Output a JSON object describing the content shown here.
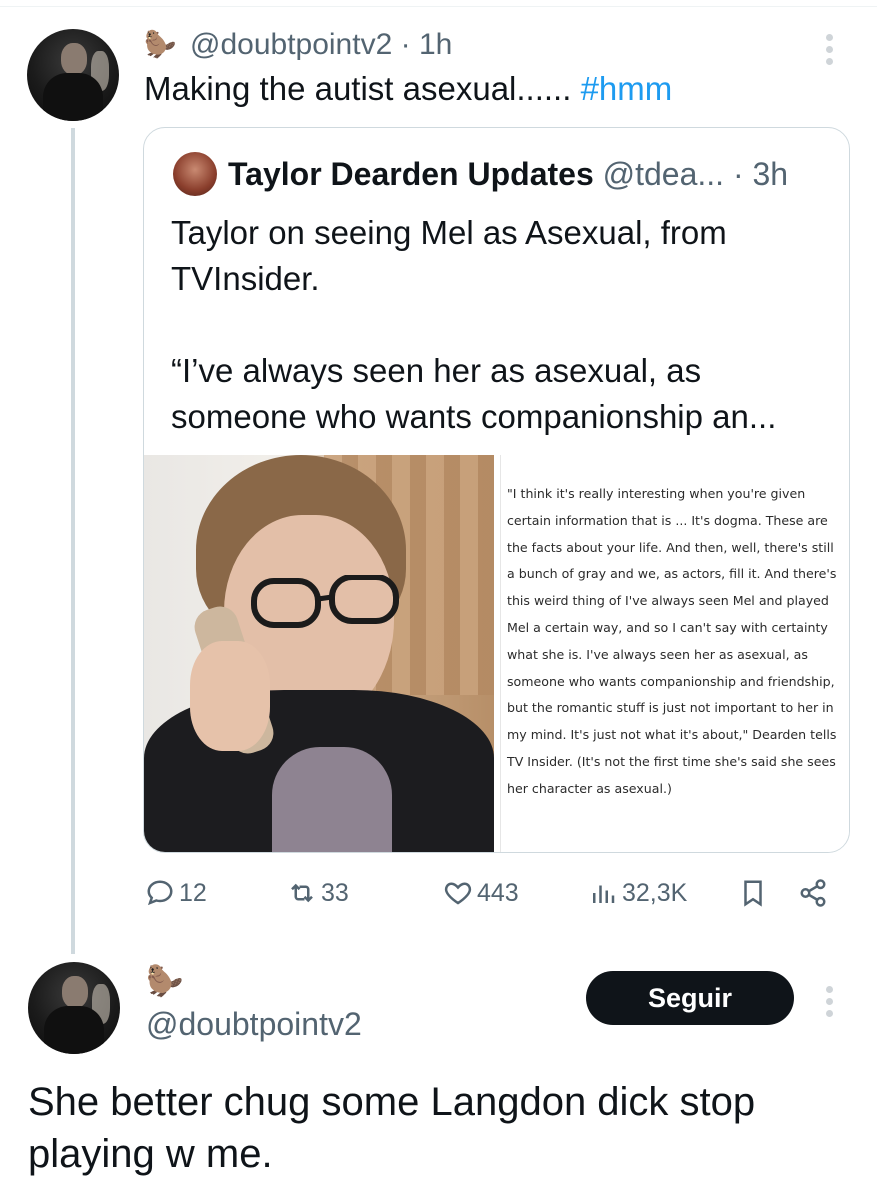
{
  "tweet": {
    "emoji": "🦫",
    "handle": "@doubtpointv2",
    "separator": "·",
    "time": "1h",
    "text": "Making the autist asexual......",
    "hashtag": "#hmm"
  },
  "quoted": {
    "name": "Taylor Dearden Updates",
    "handle_time": "@tdea... · 3h",
    "paragraph1": "Taylor on seeing Mel as Asexual, from TVInsider.",
    "paragraph2": "“I’ve always seen her as asexual, as someone who wants companionship an...",
    "image_quote": "\"I think it's really interesting when you're given certain information that is ... It's dogma. These are the facts about your life. And then, well, there's still a bunch of gray and we, as actors, fill it. And there's this weird thing of I've always seen Mel and played Mel a certain way, and so I can't say with certainty what she is. I've always seen her as asexual, as someone who wants companionship and friendship, but the romantic stuff is just not important to her in my mind. It's just not what it's about,\" Dearden tells TV Insider. (It's not the first time she's said she sees her character as asexual.)"
  },
  "actions": {
    "replies": "12",
    "reposts": "33",
    "likes": "443",
    "views": "32,3K"
  },
  "reply": {
    "emoji": "🦫",
    "follow_label": "Seguir",
    "handle": "@doubtpointv2",
    "text": "She better chug some Langdon dick stop playing w me."
  },
  "colors": {
    "accent": "#1d9bf0",
    "secondary_text": "#536471",
    "border": "#cfd9de",
    "follow_bg": "#0f1419"
  }
}
